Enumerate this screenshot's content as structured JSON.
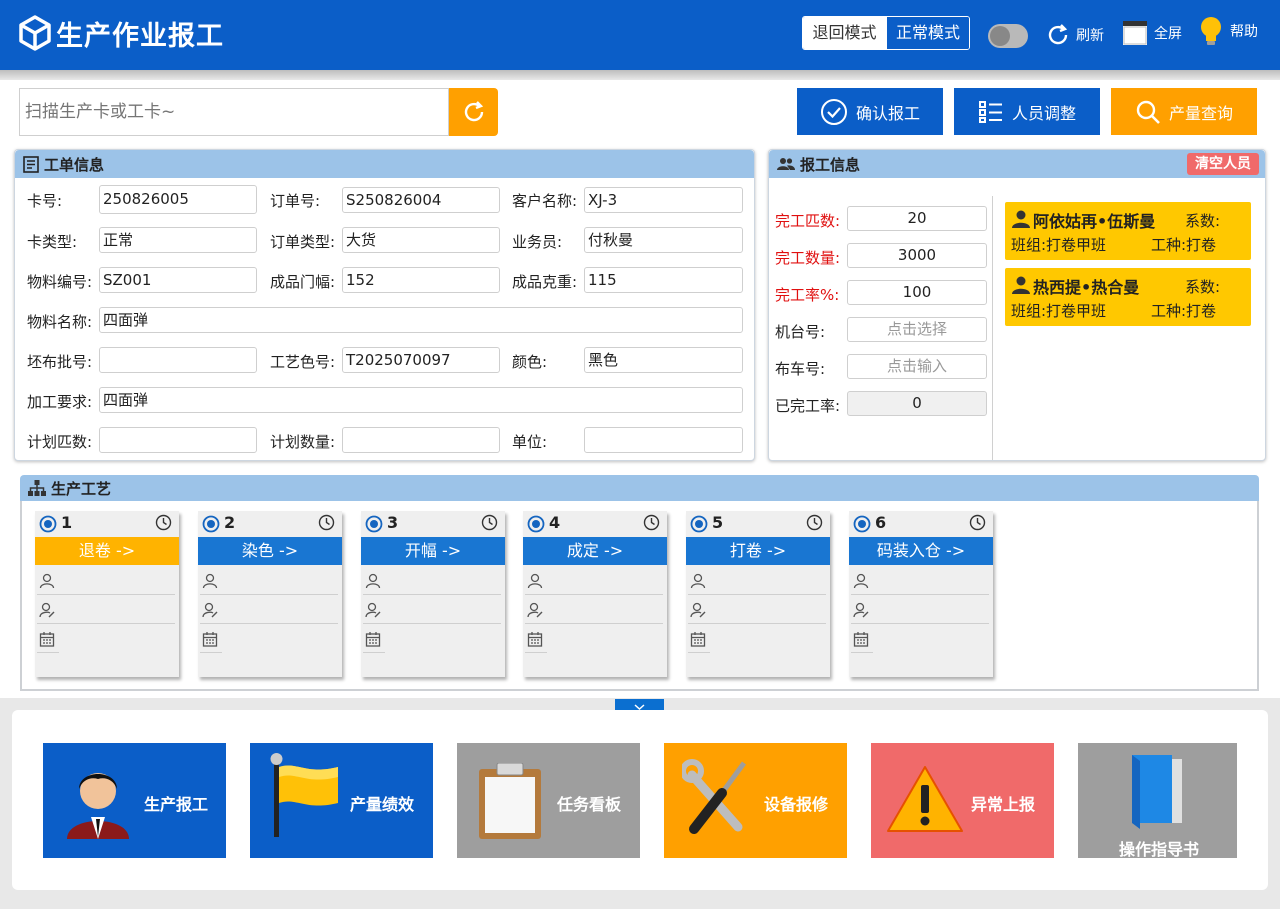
{
  "header": {
    "title": "生产作业报工",
    "mode_return": "退回模式",
    "mode_normal": "正常模式",
    "refresh": "刷新",
    "fullscreen": "全屏",
    "help": "帮助"
  },
  "toolbar": {
    "scan_placeholder": "扫描生产卡或工卡~",
    "confirm": "确认报工",
    "staff": "人员调整",
    "query": "产量查询"
  },
  "order": {
    "title": "工单信息",
    "card_no_label": "卡号:",
    "card_no": "250826005",
    "order_no_label": "订单号:",
    "order_no": "S250826004",
    "customer_label": "客户名称:",
    "customer": "XJ-3",
    "card_type_label": "卡类型:",
    "card_type": "正常",
    "order_type_label": "订单类型:",
    "order_type": "大货",
    "sales_label": "业务员:",
    "sales": "付秋曼",
    "material_no_label": "物料编号:",
    "material_no": "SZ001",
    "width_label": "成品门幅:",
    "width": "152",
    "weight_label": "成品克重:",
    "weight": "115",
    "material_name_label": "物料名称:",
    "material_name": "四面弹",
    "batch_label": "坯布批号:",
    "batch": "",
    "color_no_label": "工艺色号:",
    "color_no": "T2025070097",
    "color_label": "颜色:",
    "color": "黑色",
    "process_req_label": "加工要求:",
    "process_req": "四面弹",
    "plan_pieces_label": "计划匹数:",
    "plan_pieces": "",
    "plan_qty_label": "计划数量:",
    "plan_qty": "",
    "unit_label": "单位:",
    "unit": ""
  },
  "report": {
    "title": "报工信息",
    "clear": "清空人员",
    "pieces_label": "完工匹数:",
    "pieces": "20",
    "qty_label": "完工数量:",
    "qty": "3000",
    "rate_label": "完工率%:",
    "rate": "100",
    "machine_label": "机台号:",
    "machine_placeholder": "点击选择",
    "cart_label": "布车号:",
    "cart_placeholder": "点击输入",
    "done_rate_label": "已完工率:",
    "done_rate": "0",
    "people": [
      {
        "name": "阿依姑再•伍斯曼",
        "coef": "系数:",
        "team": "班组:打卷甲班",
        "job": "工种:打卷"
      },
      {
        "name": "热西提•热合曼",
        "coef": "系数:",
        "team": "班组:打卷甲班",
        "job": "工种:打卷"
      }
    ]
  },
  "process": {
    "title": "生产工艺",
    "steps": [
      {
        "num": "1",
        "name": "退卷 ->"
      },
      {
        "num": "2",
        "name": "染色 ->"
      },
      {
        "num": "3",
        "name": "开幅 ->"
      },
      {
        "num": "4",
        "name": "成定 ->"
      },
      {
        "num": "5",
        "name": "打卷 ->"
      },
      {
        "num": "6",
        "name": "码装入仓 ->"
      }
    ]
  },
  "tiles": {
    "t1": "生产报工",
    "t2": "产量绩效",
    "t3": "任务看板",
    "t4": "设备报修",
    "t5": "异常上报",
    "t6": "操作指导书"
  },
  "colors": {
    "primary": "#0b5ec8",
    "accent": "#ffa000",
    "active_step": "#ffb300",
    "step_bar": "#1976d2",
    "danger": "#f06a6a",
    "person_card": "#ffc800",
    "tile_gray": "#9e9e9e"
  }
}
